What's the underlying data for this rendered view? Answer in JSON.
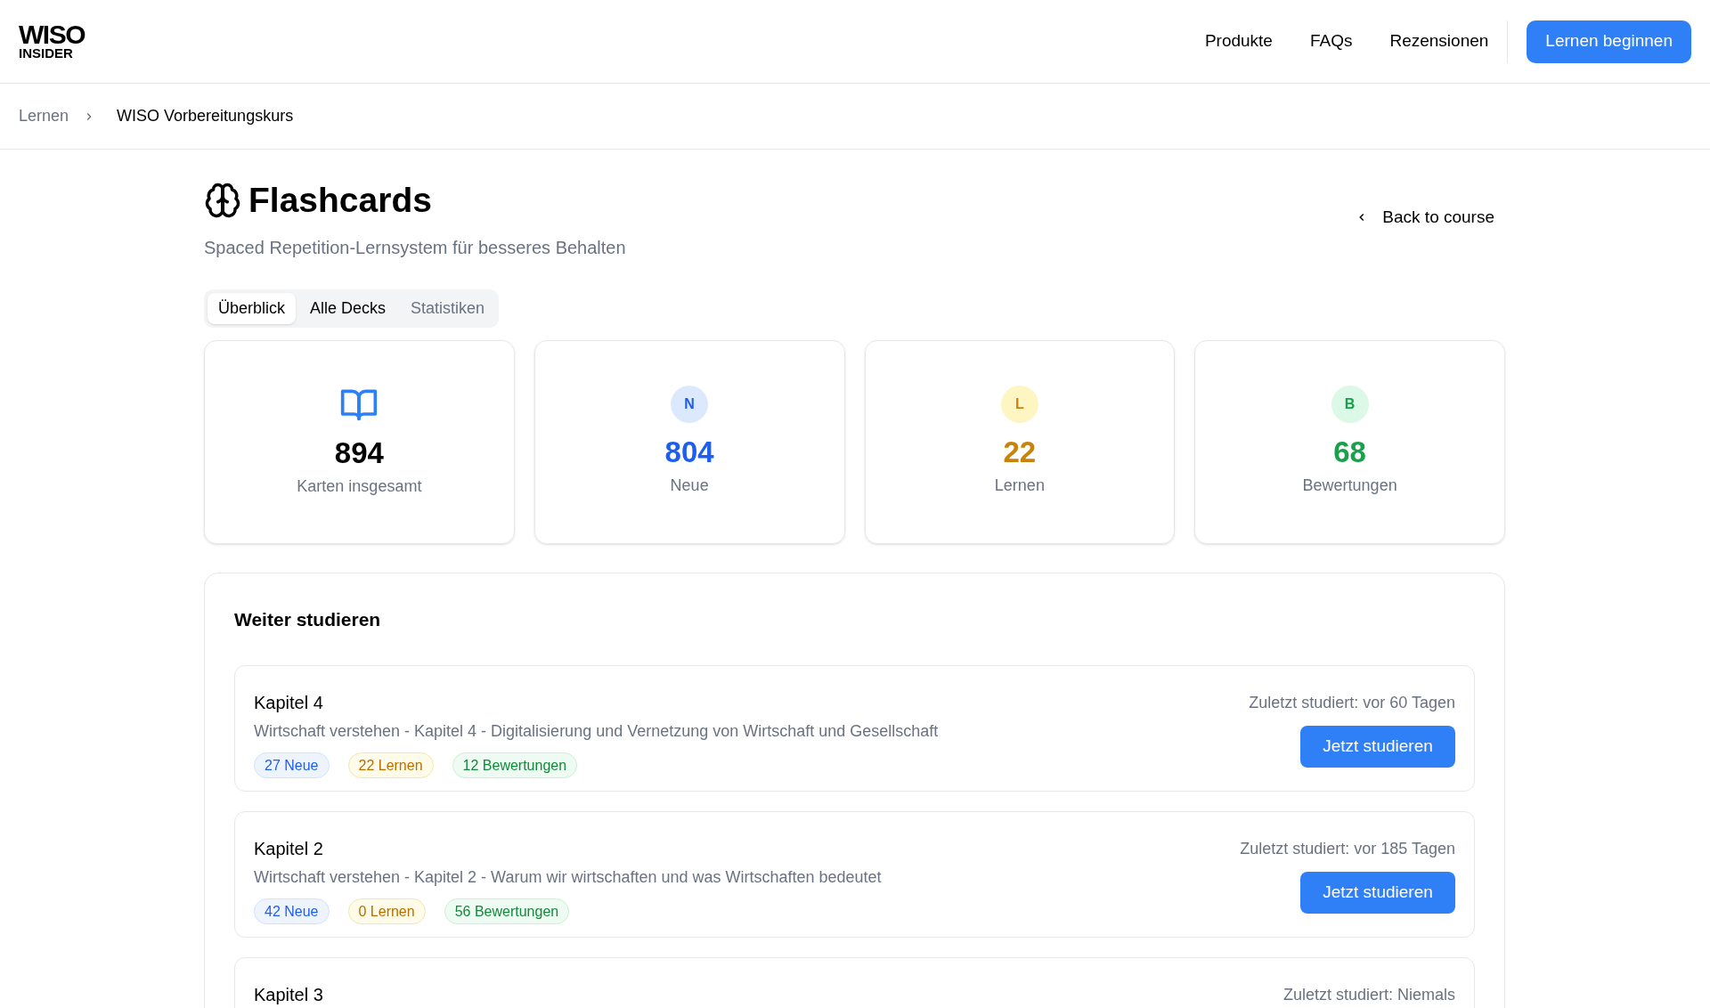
{
  "header": {
    "logo_top": "WISO",
    "logo_bottom": "INSIDER",
    "nav": [
      "Produkte",
      "FAQs",
      "Rezensionen"
    ],
    "cta": "Lernen beginnen"
  },
  "breadcrumb": [
    "Lernen",
    "WISO Vorbereitungskurs"
  ],
  "page": {
    "title": "Flashcards",
    "subtitle": "Spaced Repetition-Lernsystem für besseres Behalten",
    "back": "Back to course"
  },
  "tabs": [
    {
      "label": "Überblick",
      "selected": true,
      "disabled": false
    },
    {
      "label": "Alle Decks",
      "selected": false,
      "disabled": false
    },
    {
      "label": "Statistiken",
      "selected": false,
      "disabled": true
    }
  ],
  "stats": [
    {
      "kind": "icon",
      "value": "894",
      "label": "Karten insgesamt",
      "color": "#000000"
    },
    {
      "kind": "letter",
      "letter": "N",
      "value": "804",
      "label": "Neue",
      "color": "#1d5ef0"
    },
    {
      "kind": "letter",
      "letter": "L",
      "value": "22",
      "label": "Lernen",
      "color": "#c9820c"
    },
    {
      "kind": "letter",
      "letter": "B",
      "value": "68",
      "label": "Bewertungen",
      "color": "#18a04a"
    }
  ],
  "continue": {
    "title": "Weiter studieren",
    "decks": [
      {
        "name": "Kapitel 4",
        "description": "Wirtschaft verstehen - Kapitel 4 - Digitalisierung und Vernetzung von Wirtschaft und Gesellschaft",
        "last": "Zuletzt studiert: vor 60 Tagen",
        "button": "Jetzt studieren",
        "chips": [
          {
            "kind": "new",
            "text": "27 Neue"
          },
          {
            "kind": "learn",
            "text": "22 Lernen"
          },
          {
            "kind": "review",
            "text": "12 Bewertungen"
          }
        ]
      },
      {
        "name": "Kapitel 2",
        "description": "Wirtschaft verstehen - Kapitel 2 - Warum wir wirtschaften und was Wirtschaften bedeutet",
        "last": "Zuletzt studiert: vor 185 Tagen",
        "button": "Jetzt studieren",
        "chips": [
          {
            "kind": "new",
            "text": "42 Neue"
          },
          {
            "kind": "learn",
            "text": "0 Lernen"
          },
          {
            "kind": "review",
            "text": "56 Bewertungen"
          }
        ]
      },
      {
        "name": "Kapitel 3",
        "last": "Zuletzt studiert: Niemals"
      }
    ]
  }
}
